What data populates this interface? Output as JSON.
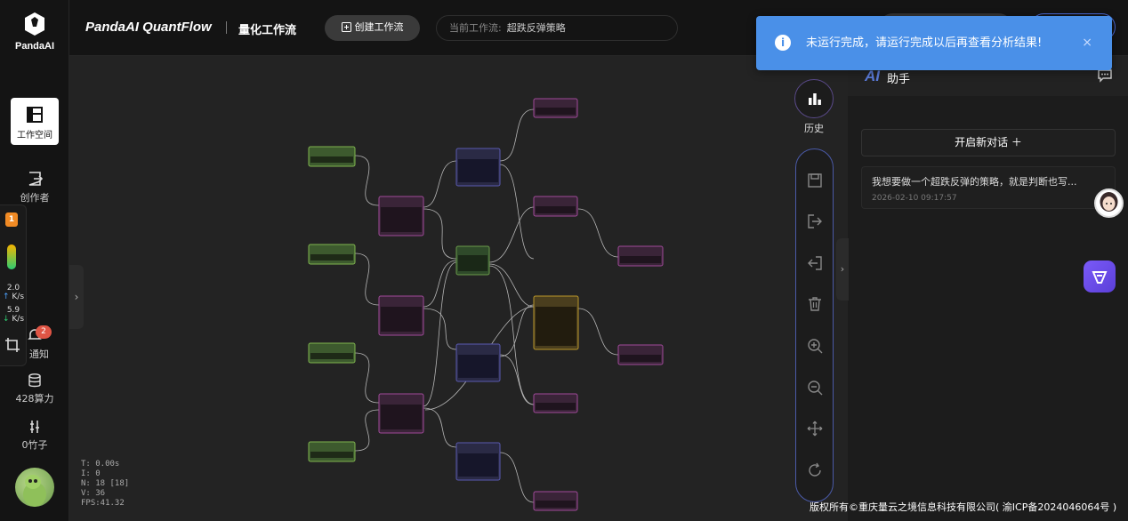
{
  "sidebar": {
    "logo_text": "PandaAI",
    "items": [
      {
        "label": "工作空间",
        "icon": "workspace-icon",
        "active": true
      },
      {
        "label": "创作者",
        "icon": "creator-icon"
      },
      {
        "label": "通知",
        "icon": "bell-icon",
        "badge": "2"
      },
      {
        "label": "428算力",
        "icon": "database-icon"
      },
      {
        "label": "0竹子",
        "icon": "bamboo-icon"
      }
    ],
    "panel": {
      "badge": "1",
      "up_value": "2.0",
      "up_unit": "K/s",
      "down_value": "5.9",
      "down_unit": "K/s"
    }
  },
  "header": {
    "brand": "PandaAI QuantFlow",
    "subtitle": "量化工作流",
    "create_button": "创建工作流",
    "current_flow_label": "当前工作流:",
    "current_flow_value": "超跌反弹策略"
  },
  "canvas": {
    "stats": [
      "T: 0.00s",
      "I: 0",
      "N: 18 [18]",
      "V: 36",
      "FPS:41.32"
    ]
  },
  "toolbar": {
    "history_label": "历史",
    "icons": [
      "save-icon",
      "export-icon",
      "import-icon",
      "delete-icon",
      "zoom-in-icon",
      "zoom-out-icon",
      "fit-view-icon",
      "refresh-icon"
    ]
  },
  "assistant": {
    "ai_logo": "AI",
    "title": "助手",
    "new_chat": "开启新对话 ＋",
    "conversations": [
      {
        "title": "我想要做一个超跌反弹的策略，就是判断也写...",
        "time": "2026-02-10 09:17:57"
      }
    ]
  },
  "toast": {
    "message": "未运行完成，请运行完成以后再查看分析结果!",
    "close": "×"
  },
  "footer": {
    "copyright": "版权所有©重庆量云之境信息科技有限公司( 渝ICP备2024046064号 )"
  },
  "colors": {
    "accent": "#4a90e8",
    "node_green": "#5a9a3a",
    "node_purple": "#8a3a8a",
    "node_blue": "#4a4a9a",
    "node_gold": "#b8962a"
  }
}
